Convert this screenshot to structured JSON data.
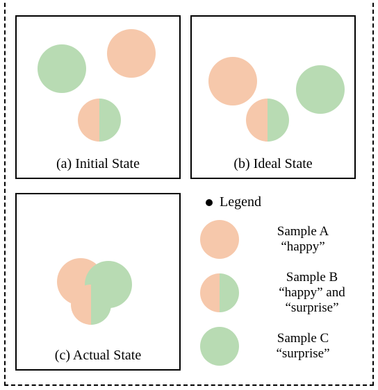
{
  "panels": {
    "a": {
      "caption": "(a) Initial State"
    },
    "b": {
      "caption": "(b) Ideal State"
    },
    "c": {
      "caption": "(c) Actual State"
    }
  },
  "legend": {
    "heading": "Legend",
    "items": [
      {
        "name": "Sample A",
        "label": "“happy”"
      },
      {
        "name": "Sample B",
        "label": "“happy” and “surprise”"
      },
      {
        "name": "Sample C",
        "label": "“surprise”"
      }
    ]
  },
  "colors": {
    "orange": "#f6c8ab",
    "green": "#b8dbb3"
  },
  "chart_data": {
    "type": "diagram",
    "title": "",
    "states": [
      {
        "id": "a",
        "label": "Initial State",
        "samples": [
          {
            "sample": "C",
            "x": 0.25,
            "y": 0.3
          },
          {
            "sample": "A",
            "x": 0.7,
            "y": 0.2
          },
          {
            "sample": "B",
            "x": 0.45,
            "y": 0.62
          }
        ],
        "note": "samples spread apart"
      },
      {
        "id": "b",
        "label": "Ideal State",
        "samples": [
          {
            "sample": "A",
            "x": 0.25,
            "y": 0.38
          },
          {
            "sample": "B",
            "x": 0.45,
            "y": 0.62
          },
          {
            "sample": "C",
            "x": 0.78,
            "y": 0.42
          }
        ],
        "note": "B between A and C"
      },
      {
        "id": "c",
        "label": "Actual State",
        "samples": [
          {
            "sample": "A",
            "x": 0.36,
            "y": 0.48
          },
          {
            "sample": "C",
            "x": 0.52,
            "y": 0.5
          },
          {
            "sample": "B",
            "x": 0.44,
            "y": 0.6
          }
        ],
        "note": "samples collapsed / overlapping"
      }
    ],
    "sample_definitions": {
      "A": {
        "labels": [
          "happy"
        ],
        "color": "orange"
      },
      "B": {
        "labels": [
          "happy",
          "surprise"
        ],
        "color": "split"
      },
      "C": {
        "labels": [
          "surprise"
        ],
        "color": "green"
      }
    }
  }
}
